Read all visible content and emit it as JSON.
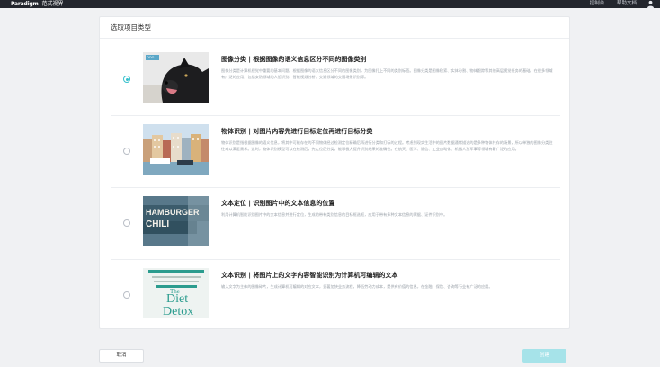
{
  "header": {
    "logo_text": "Paradigm",
    "logo_sep": "·",
    "product_name": "范式视界",
    "links": [
      "控制台",
      "帮助文档"
    ],
    "user_icon": "user-icon"
  },
  "dialog": {
    "title": "选取项目类型",
    "options": [
      {
        "title": "图像分类 | 根据图像的语义信息区分不同的图像类别",
        "description": "图像分类是计算机视觉中重要的基本问题。根据图像的语义信息区分不同的图像类别，为图像打上不同的类别标签。图像分类是图像检索、实体分割、物体跟踪等其他高层视觉任务的基础。在很多领域有广泛的应用，包括安防领域的人脸识别、智能视频分析、交通领域的交通场景识别等。",
        "selected": true,
        "thumb_tag": "DOG"
      },
      {
        "title": "物体识别 | 对图片内容先进行目标定位再进行目标分类",
        "description": "物体识别是指根据图像的语义信息，将其中可能存在的不同物体经过检测定位精确后再进行分类和打标的过程。考虑到现实生活中的图片数据通常描述的是多种物体共存的场景，所以单独的图像分类往往难以满足需求。这时，物体识别模型可以在检测后，先定位后分类，能够极大提升识别结果的准确性。在航天、医学、通信、工业自动化、机器人及军事等领域有着广泛的应用。",
        "selected": false
      },
      {
        "title": "文本定位 | 识别图片中的文本信息的位置",
        "description": "利用计算机智能识别图片中的文本信息并进行定位，生成的带有类别信息的目标框选框，应用于带有多种文本信息的票据、证件识别中。",
        "selected": false,
        "thumb_words": [
          "HAMBURGER",
          "CHILI"
        ]
      },
      {
        "title": "文本识别 | 将图片上的文字内容智能识别为计算机可编辑的文本",
        "description": "输入文字为主体的图像碎片，生成计算机可编辑的对应文本，显著加快业务流程，降低劳动力成本，提供有价值的信息，在金融、保险、咨询等行业有广泛的应用。",
        "selected": false,
        "thumb_words": [
          "The",
          "Diet",
          "Detox"
        ]
      }
    ]
  },
  "buttons": {
    "cancel": "取消",
    "confirm": "创建"
  },
  "colors": {
    "topbar": "#23262d",
    "accent": "#36c0cc",
    "confirm_disabled": "#a6e3e9"
  }
}
